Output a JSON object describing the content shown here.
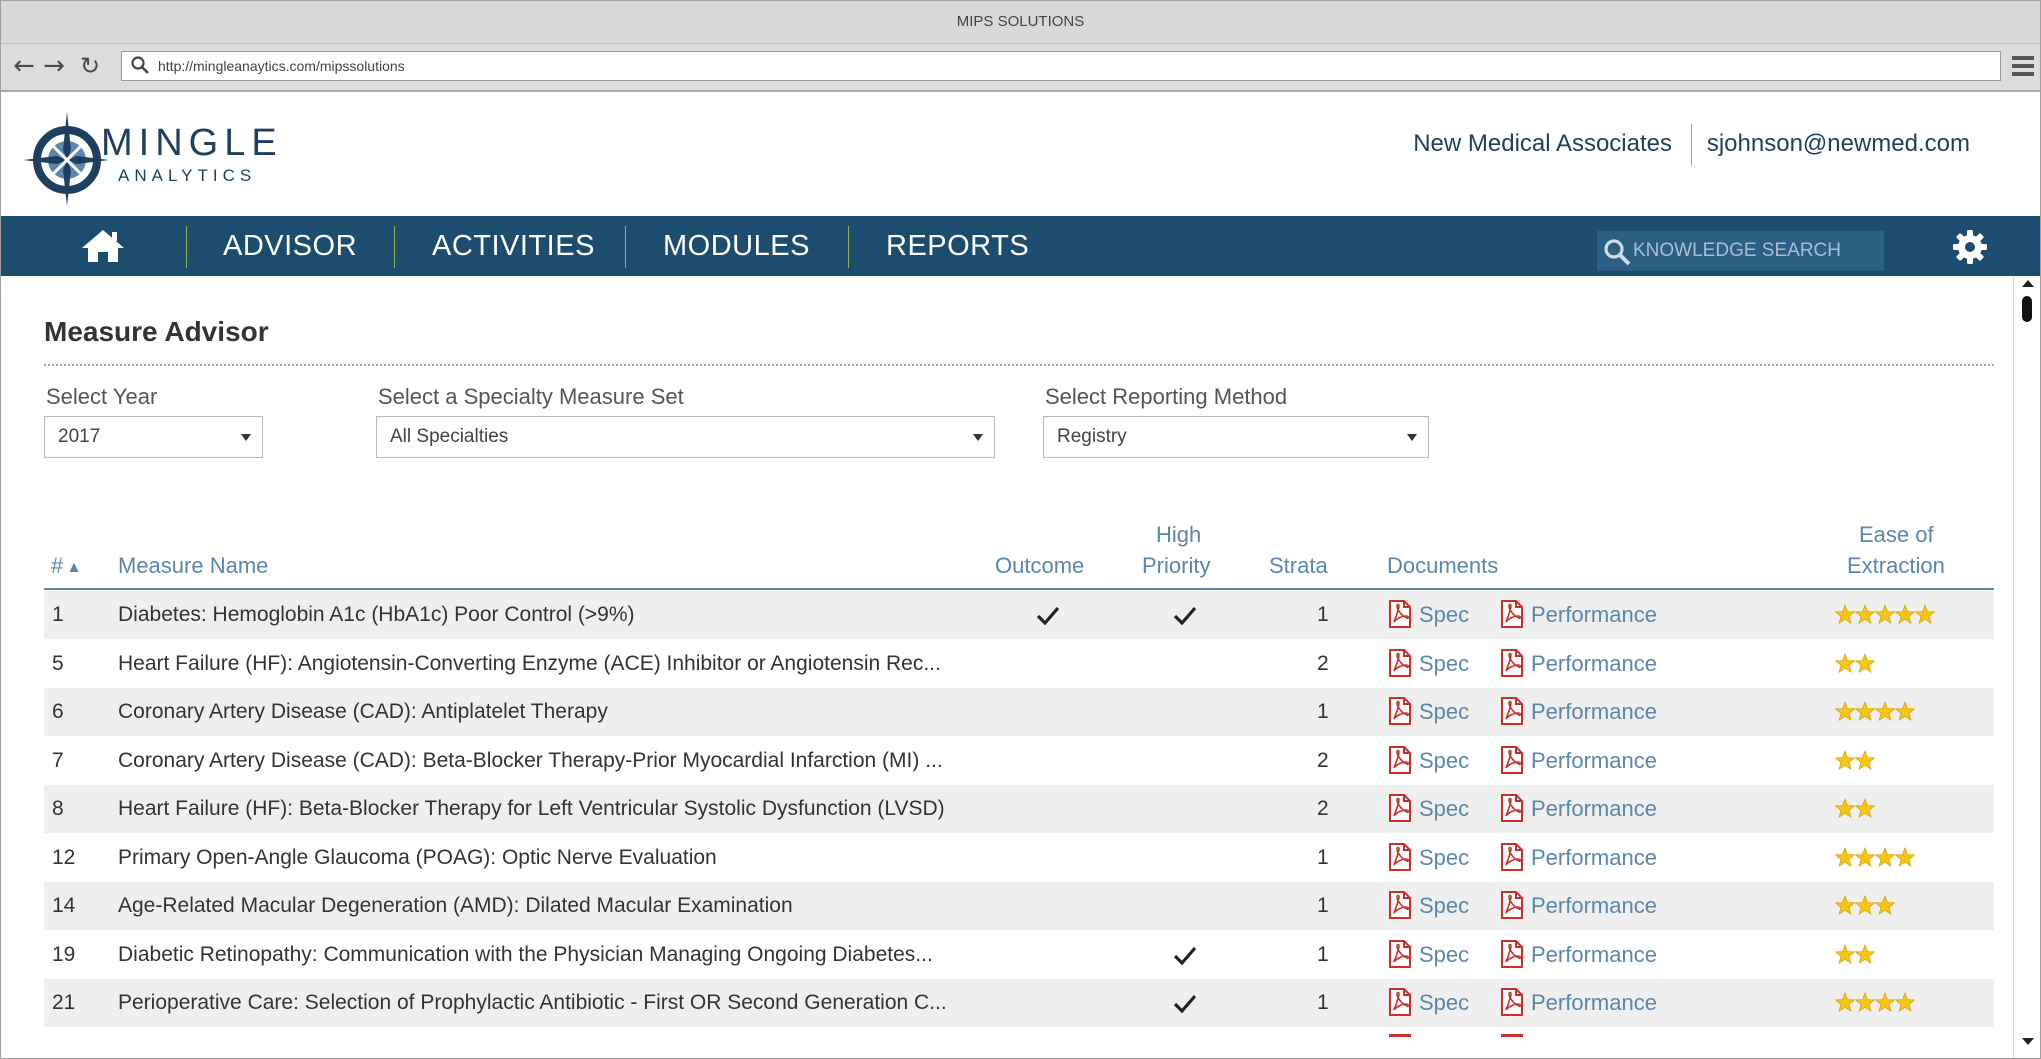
{
  "window": {
    "title": "MIPS SOLUTIONS"
  },
  "browser": {
    "url": "http://mingleanaytics.com/mipssolutions"
  },
  "brand": {
    "name": "MINGLE",
    "subname": "ANALYTICS"
  },
  "header": {
    "organization": "New Medical Associates",
    "user_email": "sjohnson@newmed.com"
  },
  "nav": {
    "items": [
      "ADVISOR",
      "ACTIVITIES",
      "MODULES",
      "REPORTS"
    ],
    "search_placeholder": "KNOWLEDGE SEARCH"
  },
  "page": {
    "title": "Measure Advisor"
  },
  "filters": {
    "year": {
      "label": "Select Year",
      "value": "2017"
    },
    "specialty": {
      "label": "Select a Specialty Measure Set",
      "value": "All Specialties"
    },
    "method": {
      "label": "Select Reporting Method",
      "value": "Registry"
    }
  },
  "table": {
    "columns": {
      "num": "#",
      "name": "Measure Name",
      "outcome": "Outcome",
      "high_priority_1": "High",
      "high_priority_2": "Priority",
      "strata": "Strata",
      "documents": "Documents",
      "ease_1": "Ease of",
      "ease_2": "Extraction"
    },
    "doc_labels": {
      "spec": "Spec",
      "performance": "Performance"
    },
    "star_color": "#f5c518",
    "rows": [
      {
        "num": "1",
        "name": "Diabetes: Hemoglobin A1c (HbA1c) Poor Control (>9%)",
        "outcome": true,
        "high_priority": true,
        "strata": "1",
        "ease": 5
      },
      {
        "num": "5",
        "name": "Heart Failure (HF): Angiotensin-Converting Enzyme (ACE) Inhibitor or Angiotensin Rec...",
        "outcome": false,
        "high_priority": false,
        "strata": "2",
        "ease": 2
      },
      {
        "num": "6",
        "name": "Coronary Artery Disease (CAD): Antiplatelet Therapy",
        "outcome": false,
        "high_priority": false,
        "strata": "1",
        "ease": 4
      },
      {
        "num": "7",
        "name": "Coronary Artery Disease (CAD): Beta-Blocker Therapy-Prior Myocardial Infarction (MI) ...",
        "outcome": false,
        "high_priority": false,
        "strata": "2",
        "ease": 2
      },
      {
        "num": "8",
        "name": "Heart Failure (HF): Beta-Blocker Therapy for Left Ventricular Systolic Dysfunction (LVSD)",
        "outcome": false,
        "high_priority": false,
        "strata": "2",
        "ease": 2
      },
      {
        "num": "12",
        "name": "Primary Open-Angle Glaucoma (POAG): Optic Nerve Evaluation",
        "outcome": false,
        "high_priority": false,
        "strata": "1",
        "ease": 4
      },
      {
        "num": "14",
        "name": "Age-Related Macular Degeneration (AMD): Dilated Macular Examination",
        "outcome": false,
        "high_priority": false,
        "strata": "1",
        "ease": 3
      },
      {
        "num": "19",
        "name": "Diabetic Retinopathy: Communication with the Physician Managing Ongoing Diabetes...",
        "outcome": false,
        "high_priority": true,
        "strata": "1",
        "ease": 2
      },
      {
        "num": "21",
        "name": "Perioperative Care: Selection of Prophylactic Antibiotic - First OR Second Generation C...",
        "outcome": false,
        "high_priority": true,
        "strata": "1",
        "ease": 4
      }
    ]
  }
}
